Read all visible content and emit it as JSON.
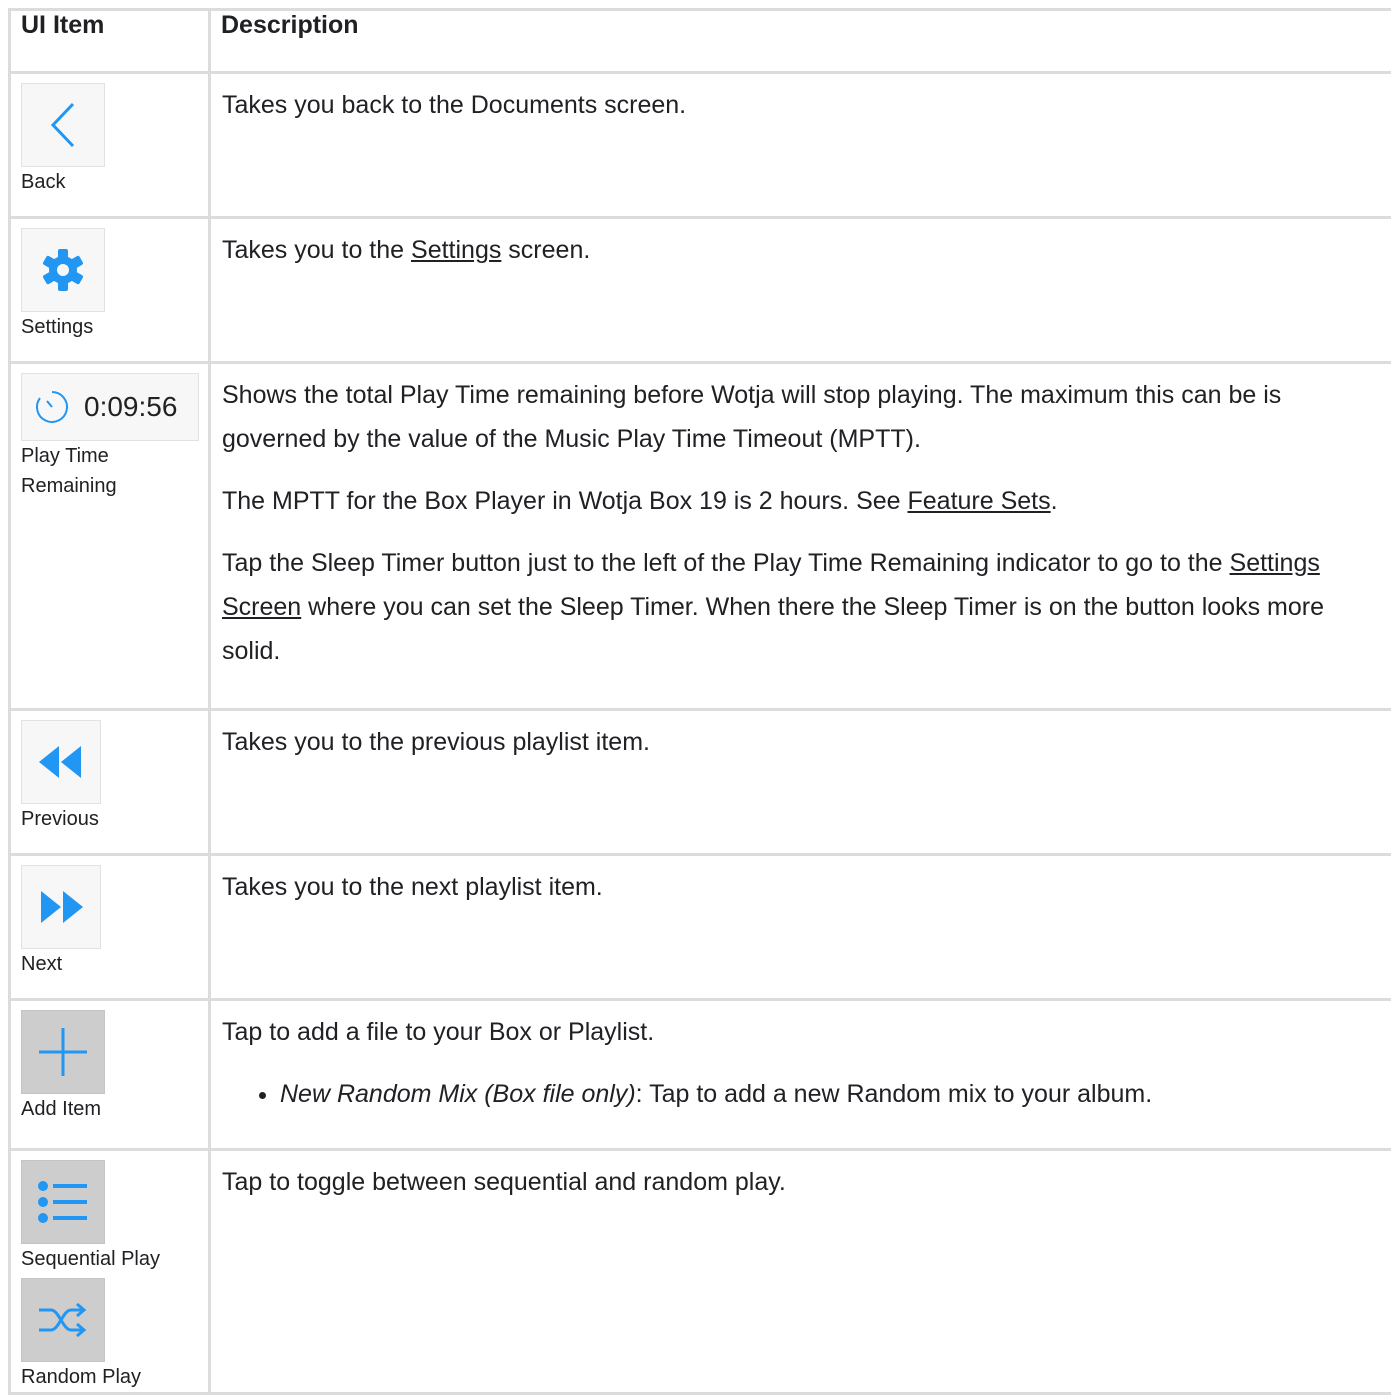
{
  "table": {
    "header": {
      "col1": "UI Item",
      "col2": "Description"
    },
    "rows": {
      "back": {
        "label": "Back",
        "desc": "Takes you back to the Documents screen."
      },
      "settings": {
        "label": "Settings",
        "desc_before": "Takes you to the ",
        "link": "Settings",
        "desc_after": " screen."
      },
      "play_time": {
        "time": "0:09:56",
        "label": "Play Time Remaining",
        "p1": "Shows the total Play Time remaining before Wotja will stop playing. The maximum this can be is governed by the value of the Music Play Time Timeout (MPTT).",
        "p2_before": "The MPTT for the Box Player in Wotja Box 19 is 2 hours. See ",
        "p2_link": "Feature Sets",
        "p2_after": ".",
        "p3_before": "Tap the Sleep Timer button just to the left of the Play Time Remaining indicator to go to the ",
        "p3_link": "Settings Screen",
        "p3_after": " where you can set the Sleep Timer. When there the Sleep Timer is on the button looks more solid."
      },
      "previous": {
        "label": "Previous",
        "desc": "Takes you to the previous playlist item."
      },
      "next": {
        "label": "Next",
        "desc": "Takes you to the next playlist item."
      },
      "add_item": {
        "label": "Add Item",
        "desc": "Tap to add a file to your Box or Playlist.",
        "bullet_em": "New Random Mix (Box file only)",
        "bullet_rest": ": Tap to add a new Random mix to your album."
      },
      "play_mode": {
        "label_seq": "Sequential Play",
        "label_rand": "Random Play",
        "desc": "Tap to toggle between sequential and random play."
      }
    }
  },
  "colors": {
    "accent": "#2196f3",
    "border": "#dcdcdc"
  },
  "icons": [
    "chevron-left-icon",
    "gear-icon",
    "timer-icon",
    "rewind-icon",
    "fast-forward-icon",
    "plus-icon",
    "list-icon",
    "shuffle-icon"
  ]
}
